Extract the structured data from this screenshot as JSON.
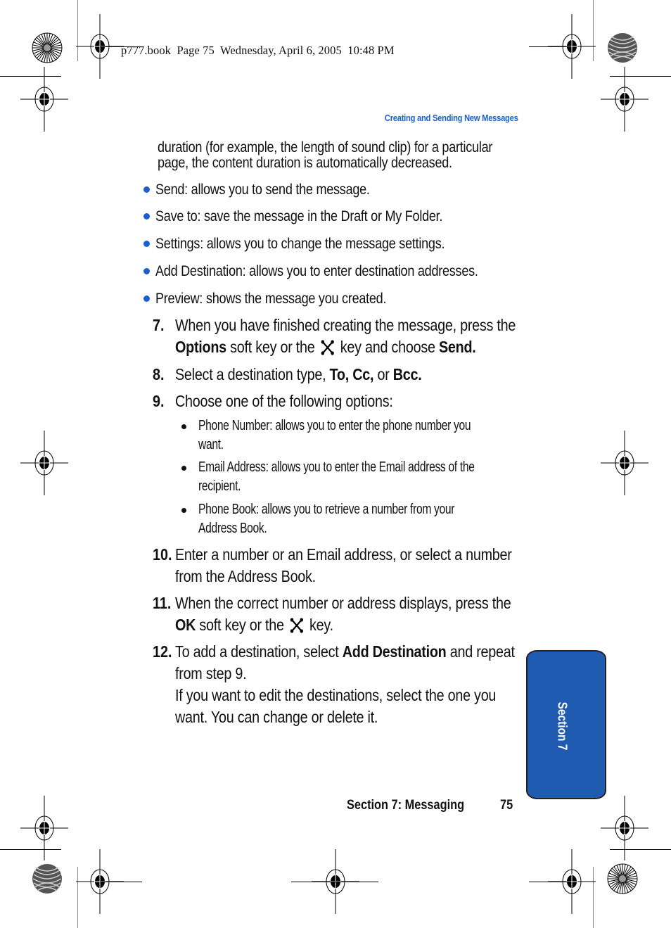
{
  "slug": "p777.book  Page 75  Wednesday, April 6, 2005  10:48 PM",
  "running_head": "Creating and Sending New Messages",
  "continuation": [
    "duration (for example, the length of sound clip) for a particular",
    "page, the content duration is automatically decreased."
  ],
  "bullets": [
    "Send: allows you to send the message.",
    "Save to: save the message in the Draft or My Folder.",
    "Settings: allows you to change the message settings.",
    "Add Destination: allows you to enter destination addresses.",
    "Preview: shows the message you created."
  ],
  "steps": {
    "s7": {
      "num": "7.",
      "line1": "When you have finished creating the message, press the",
      "bold1": "Options",
      "mid": " soft key or the ",
      "after_icon": " key and choose ",
      "bold2": "Send."
    },
    "s8": {
      "num": "8.",
      "pre": "Select a destination type, ",
      "bold1": "To, Cc,",
      "mid": " or ",
      "bold2": "Bcc."
    },
    "s9": {
      "num": "9.",
      "line1": "Choose one of the following options:",
      "sub": [
        {
          "line1": "Phone Number: allows you to enter the phone number you",
          "line2": "want."
        },
        {
          "line1": "Email Address: allows you to enter the Email address of the",
          "line2": "recipient."
        },
        {
          "line1": "Phone Book: allows you to retrieve a number from your",
          "line2": "Address Book."
        }
      ]
    },
    "s10": {
      "num": "10.",
      "line1": "Enter a number or an Email address, or select a number",
      "line2": "from the Address Book."
    },
    "s11": {
      "num": "11.",
      "line1": "When the correct number or address displays, press the",
      "bold1": "OK",
      "mid": " soft key or the ",
      "after_icon": " key."
    },
    "s12": {
      "num": "12.",
      "pre": "To add a destination, select ",
      "bold1": "Add Destination",
      "post": " and repeat",
      "line2": "from step 9.",
      "line3": "If you want to edit the destinations, select the one you",
      "line4": "want. You can change or delete it."
    }
  },
  "section_tab": "Section 7",
  "footer": {
    "section": "Section 7: Messaging",
    "page": "75"
  },
  "colors": {
    "accent_blue": "#1a5fcf",
    "tab_blue": "#1f5bb0"
  }
}
